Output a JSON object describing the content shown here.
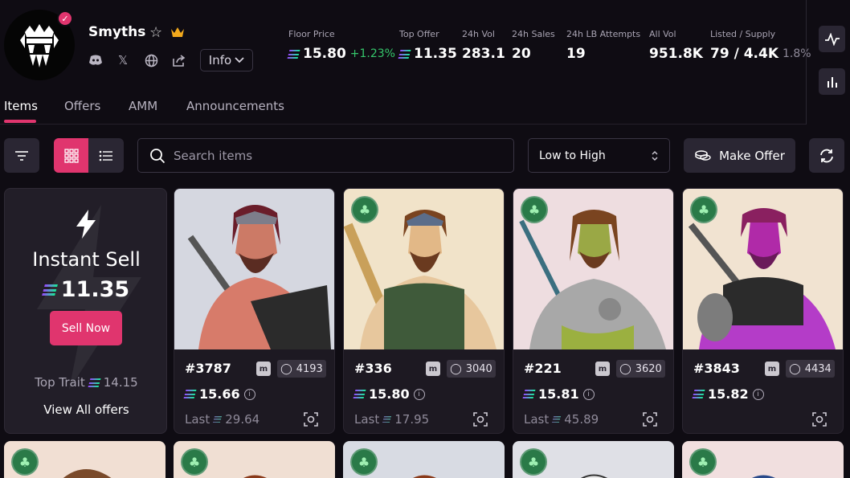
{
  "collection": {
    "name": "Smyths",
    "info_label": "Info",
    "icons": [
      "star-icon",
      "crown-icon",
      "discord-icon",
      "x-icon",
      "globe-icon",
      "share-icon"
    ]
  },
  "stats": [
    {
      "label": "Floor Price",
      "value": "15.80",
      "change": "+1.23%",
      "currency": true
    },
    {
      "label": "Top Offer",
      "value": "11.35",
      "currency": true
    },
    {
      "label": "24h Vol",
      "value": "283.1"
    },
    {
      "label": "24h Sales",
      "value": "20"
    },
    {
      "label": "24h LB Attempts",
      "value": "19"
    },
    {
      "label": "All Vol",
      "value": "951.8K"
    },
    {
      "label": "Listed / Supply",
      "value": "79 / 4.4K",
      "sub": "1.8%"
    }
  ],
  "tabs": [
    "Items",
    "Offers",
    "AMM",
    "Announcements"
  ],
  "toolbar": {
    "search_placeholder": "Search items",
    "sort_value": "Low to High",
    "make_offer_label": "Make Offer"
  },
  "instant_sell": {
    "title": "Instant Sell",
    "price": "11.35",
    "button_label": "Sell Now",
    "top_trait_label": "Top Trait",
    "top_trait_value": "14.15",
    "view_all_label": "View All offers"
  },
  "items": [
    {
      "name": "#3787",
      "rank": "4193",
      "price": "15.66",
      "last_label": "Last",
      "last": "29.64",
      "clover": false,
      "bg": "#d5d7e0"
    },
    {
      "name": "#336",
      "rank": "3040",
      "price": "15.80",
      "last_label": "Last",
      "last": "17.95",
      "clover": true,
      "bg": "#f1e3c9"
    },
    {
      "name": "#221",
      "rank": "3620",
      "price": "15.81",
      "last_label": "Last",
      "last": "45.89",
      "clover": true,
      "bg": "#eedde0"
    },
    {
      "name": "#3843",
      "rank": "4434",
      "price": "15.82",
      "clover": true,
      "bg": "#f1e3d1"
    }
  ],
  "row2_bgs": [
    "#f1dfd3",
    "#f0dfd3",
    "#d8dbe3",
    "#dfe0e6",
    "#f1dfdf"
  ]
}
